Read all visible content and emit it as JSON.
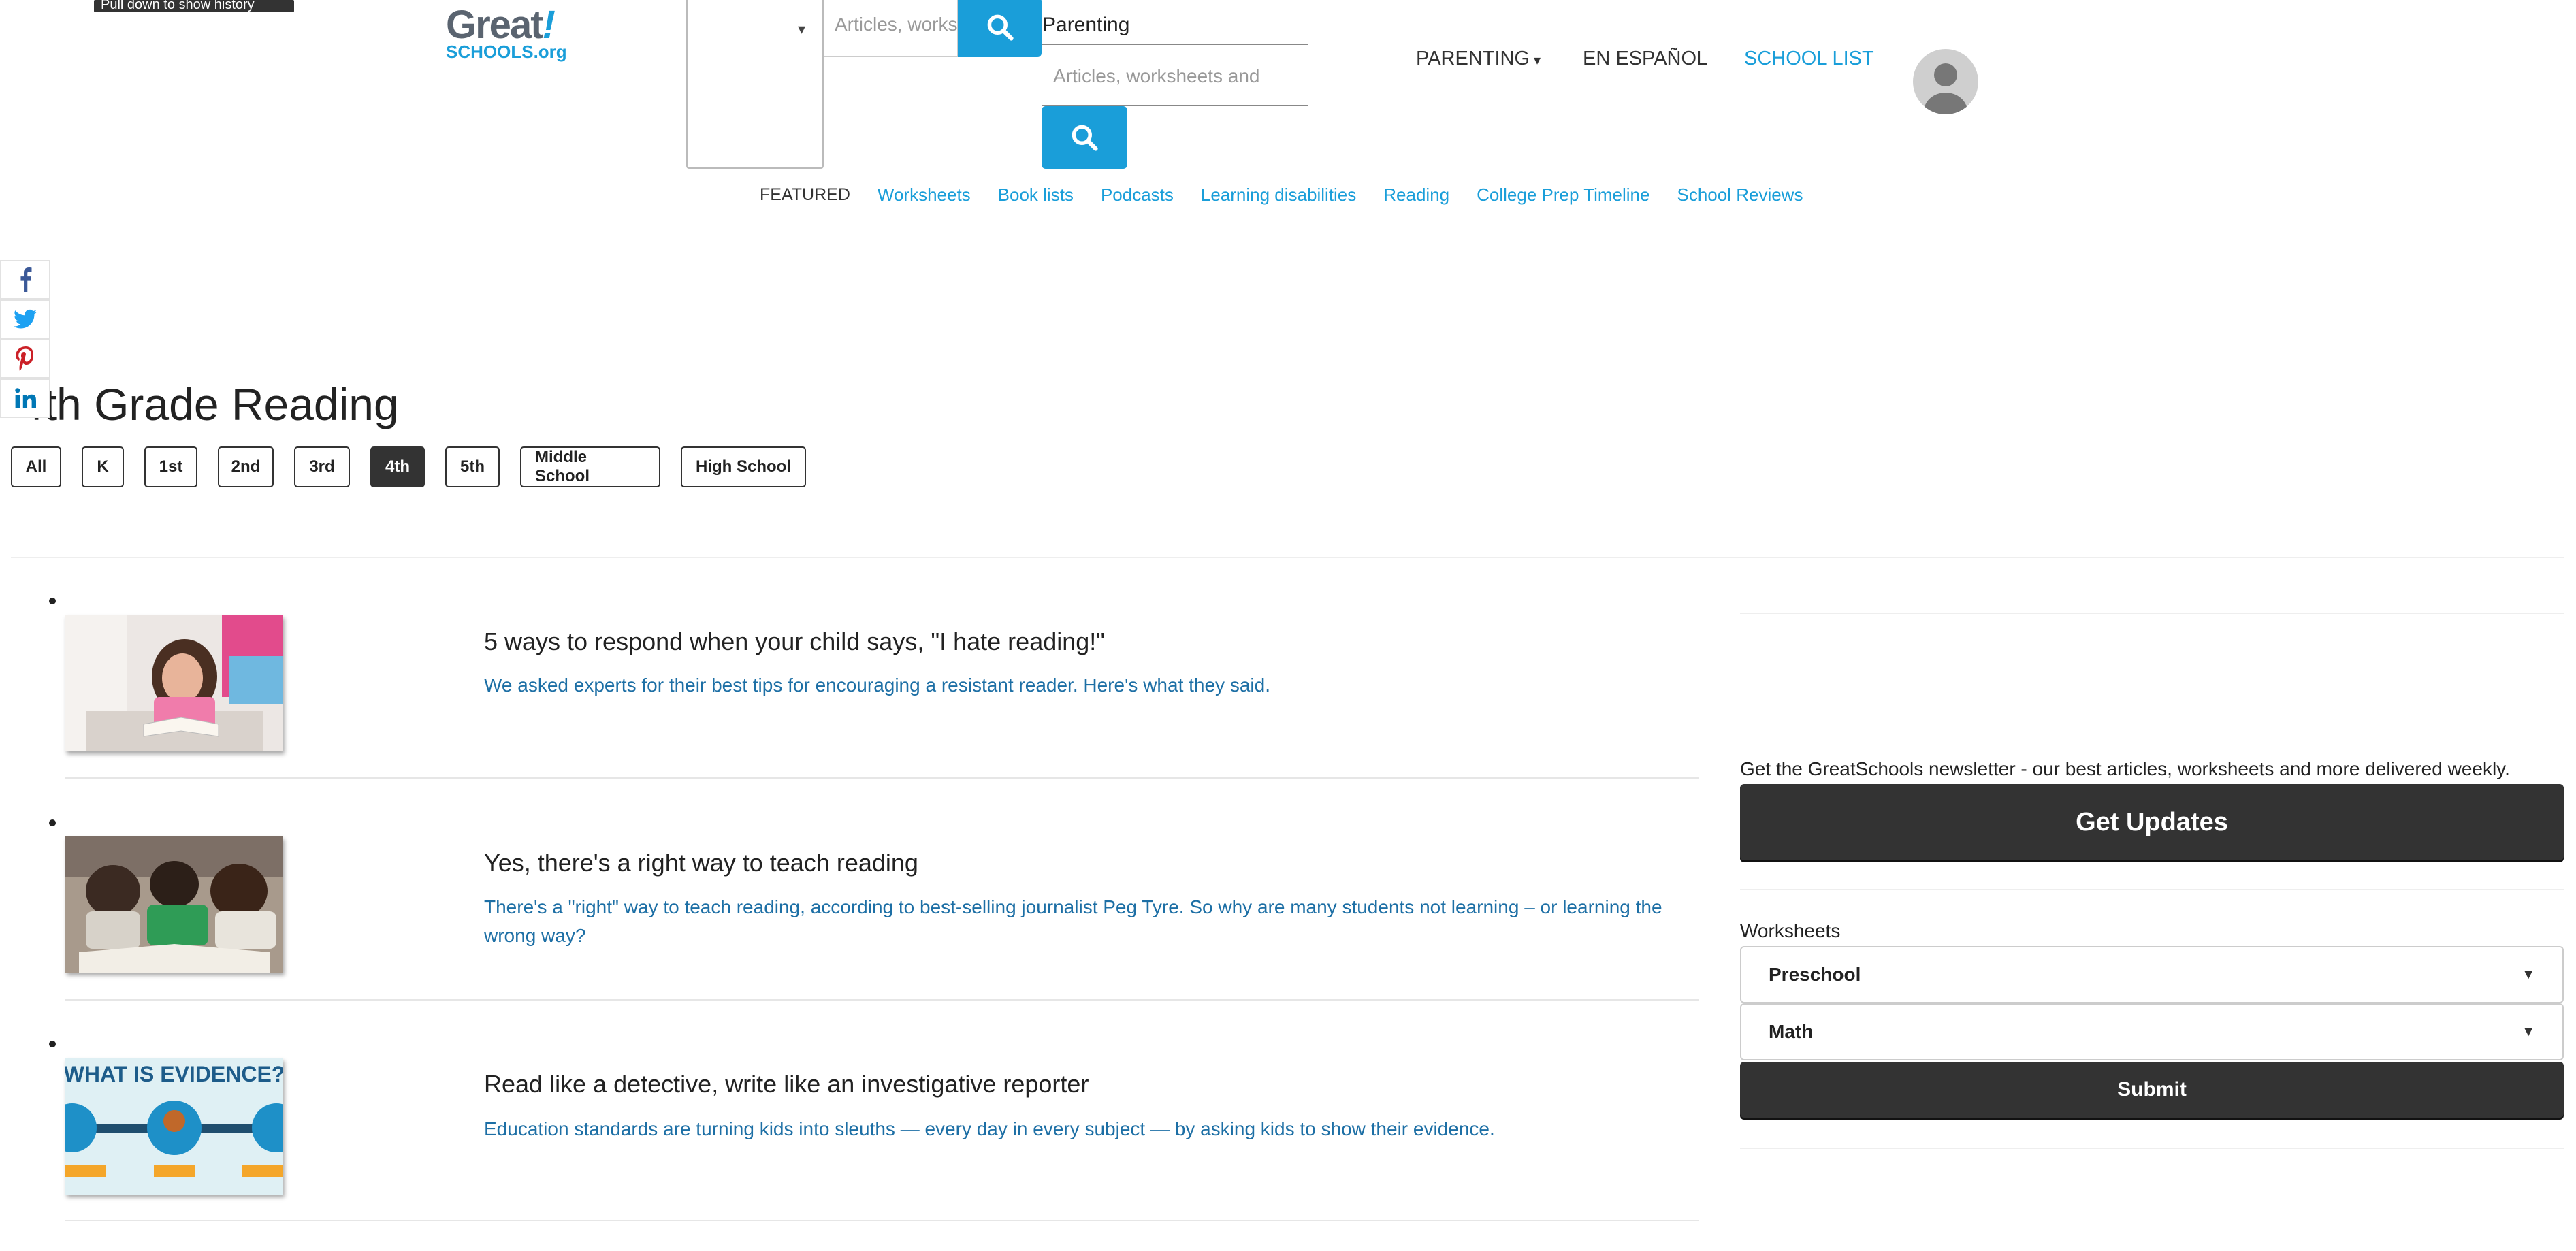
{
  "tooltip": "Pull down to show history",
  "logo": {
    "main": "Great",
    "bang": "!",
    "sub": "SCHOOLS.org"
  },
  "search": {
    "placeholder_short": "Articles, works",
    "topic_label": "Parenting",
    "placeholder": "Articles, worksheets and"
  },
  "nav": {
    "parenting": "PARENTING",
    "espanol": "EN ESPAÑOL",
    "school_list": "SCHOOL LIST"
  },
  "featured": {
    "label": "FEATURED",
    "links": [
      "Worksheets",
      "Book lists",
      "Podcasts",
      "Learning disabilities",
      "Reading",
      "College Prep Timeline",
      "School Reviews"
    ]
  },
  "page": {
    "title": "4th Grade Reading"
  },
  "grades": {
    "buttons": [
      "All",
      "K",
      "1st",
      "2nd",
      "3rd",
      "4th",
      "5th",
      "Middle School",
      "High School"
    ],
    "active": "4th"
  },
  "articles": [
    {
      "title": "5 ways to respond when your child says, \"I hate reading!\"",
      "description": "We asked experts for their best tips for encouraging a resistant reader. Here's what they said."
    },
    {
      "title": "Yes, there's a right way to teach reading",
      "description": "There's a \"right\" way to teach reading, according to best-selling journalist Peg Tyre. So why are many students not learning – or learning the wrong way?"
    },
    {
      "title": "Read like a detective, write like an investigative reporter",
      "description": "Education standards are turning kids into sleuths — every day in every subject — by asking kids to show their evidence."
    }
  ],
  "thumb3": {
    "text": "WHAT IS EVIDENCE?"
  },
  "sidebar": {
    "newsletter": "Get the GreatSchools newsletter - our best articles, worksheets and more delivered weekly.",
    "get_updates": "Get Updates",
    "worksheets_label": "Worksheets",
    "grade_select": "Preschool",
    "subject_select": "Math",
    "submit": "Submit"
  },
  "colors": {
    "accent": "#1a9ed9",
    "link": "#1d6fa5",
    "dark": "#333333"
  }
}
